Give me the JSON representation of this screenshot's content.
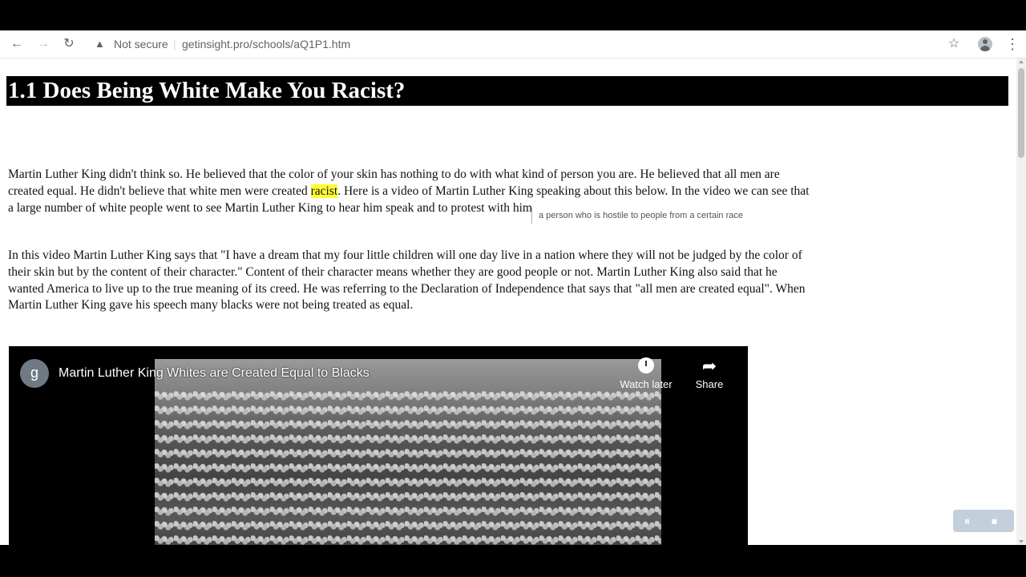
{
  "browser": {
    "security_label": "Not secure",
    "url": "getinsight.pro/schools/aQ1P1.htm",
    "icons": {
      "back": "back-arrow-icon",
      "forward": "forward-arrow-icon",
      "reload": "reload-icon",
      "warning": "warning-icon",
      "star": "star-icon",
      "profile": "profile-icon",
      "menu": "kebab-menu-icon"
    }
  },
  "page": {
    "title": "1.1 Does Being White Make You Racist?",
    "p1": {
      "before": "Martin Luther King didn't think so.  He believed that the color of your skin has nothing to do with what kind of person you are.  He believed that all men are created equal.  He didn't believe that white men were created ",
      "highlight": "racist",
      "after": ".  Here is a video of Martin Luther King speaking about this below.  In the video we can see that a large number of white people went to see Martin Luther King to hear him speak and to protest with him."
    },
    "tooltip": "a person who is hostile to people from a certain race",
    "p2": "In this video Martin Luther King says that \"I have a dream that my four little children will one day live in a nation where they will not be judged by the color of their skin but by the content of their character.\"  Content of their character means whether they are good people or not.  Martin Luther King also said that he wanted America to live up to the true meaning of its creed.  He was referring to the Declaration of Independence that says that \"all men are created equal\".  When Martin Luther King gave his speech many blacks were not being treated as equal."
  },
  "video": {
    "channel_initial": "g",
    "title": "Martin Luther King Whites are Created Equal to Blacks",
    "watch_later": "Watch later",
    "share": "Share"
  },
  "controls": {
    "pause_icon": "⏸",
    "stop_icon": "⏹"
  }
}
